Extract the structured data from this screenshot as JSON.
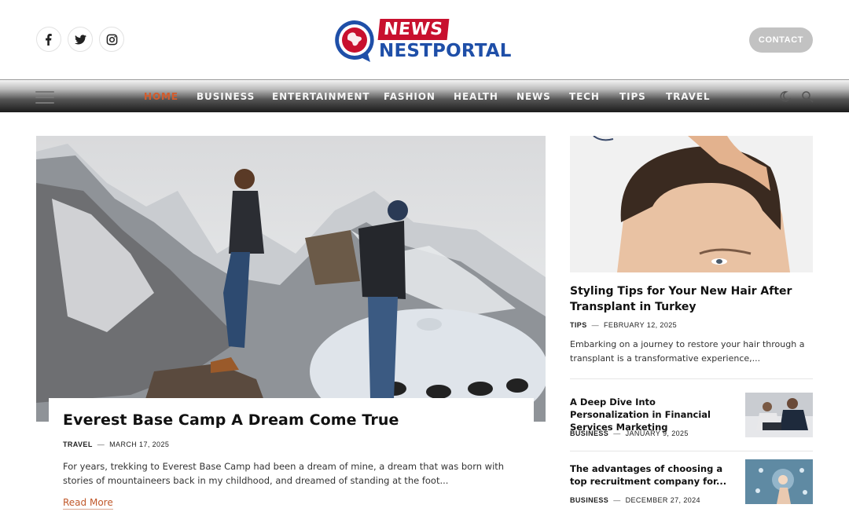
{
  "header": {
    "logo": {
      "top_text": "NEWS",
      "bottom_text": "NESTPORTAL"
    },
    "contact_label": "CONTACT",
    "social": [
      "facebook-icon",
      "twitter-icon",
      "instagram-icon"
    ]
  },
  "nav": {
    "items": [
      {
        "label": "HOME",
        "active": true
      },
      {
        "label": "BUSINESS"
      },
      {
        "label": "ENTERTAINMENT"
      },
      {
        "label": "FASHION"
      },
      {
        "label": "HEALTH"
      },
      {
        "label": "NEWS"
      },
      {
        "label": "TECH"
      },
      {
        "label": "TIPS"
      },
      {
        "label": "TRAVEL"
      }
    ]
  },
  "featured": {
    "title": "Everest Base Camp A Dream Come True",
    "category": "TRAVEL",
    "date": "MARCH 17, 2025",
    "excerpt": "For years, trekking to Everest Base Camp had been a dream of mine, a dream that was born with stories of mountaineers back in my childhood, and dreamed of standing at the foot...",
    "read_more": "Read More"
  },
  "sidebar": {
    "main_post": {
      "title": "Styling Tips for Your New Hair After Transplant in Turkey",
      "category": "TIPS",
      "date": "FEBRUARY 12, 2025",
      "excerpt": "Embarking on a journey to restore your hair through a transplant is a transformative experience,..."
    },
    "posts": [
      {
        "title": "A Deep Dive Into Personalization in Financial Services Marketing",
        "category": "BUSINESS",
        "date": "JANUARY 9, 2025"
      },
      {
        "title": " The advantages of choosing a top recruitment company for...",
        "category": "BUSINESS",
        "date": "DECEMBER 27, 2024"
      }
    ]
  },
  "colors": {
    "accent": "#d35c2c",
    "logo_red": "#c8102e",
    "logo_blue": "#1f4fa8",
    "contact_bg": "#c2c2c2"
  }
}
